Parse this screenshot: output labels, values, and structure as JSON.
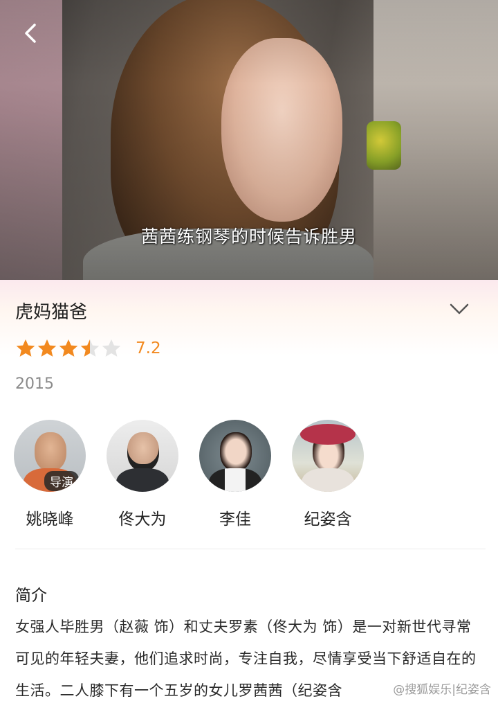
{
  "video": {
    "subtitle": "茜茜练钢琴的时候告诉胜男",
    "back_icon": "chevron-left-icon"
  },
  "show": {
    "title": "虎妈猫爸",
    "rating": 7.2,
    "rating_text": "7.2",
    "stars_filled": 3.5,
    "stars_total": 5,
    "year": "2015"
  },
  "cast": [
    {
      "name": "姚晓峰",
      "tag": "导演"
    },
    {
      "name": "佟大为",
      "tag": ""
    },
    {
      "name": "李佳",
      "tag": ""
    },
    {
      "name": "纪姿含",
      "tag": ""
    }
  ],
  "intro": {
    "heading": "简介",
    "text": "女强人毕胜男（赵薇 饰）和丈夫罗素（佟大为 饰）是一对新世代寻常可见的年轻夫妻，他们追求时尚，专注自我，尽情享受当下舒适自在的生活。二人膝下有一个五岁的女儿罗茜茜（纪姿含"
  },
  "colors": {
    "star": "#f2891f",
    "star_empty": "#e3e3e3",
    "score": "#f2891f"
  },
  "watermark": "@搜狐娱乐|纪姿含"
}
